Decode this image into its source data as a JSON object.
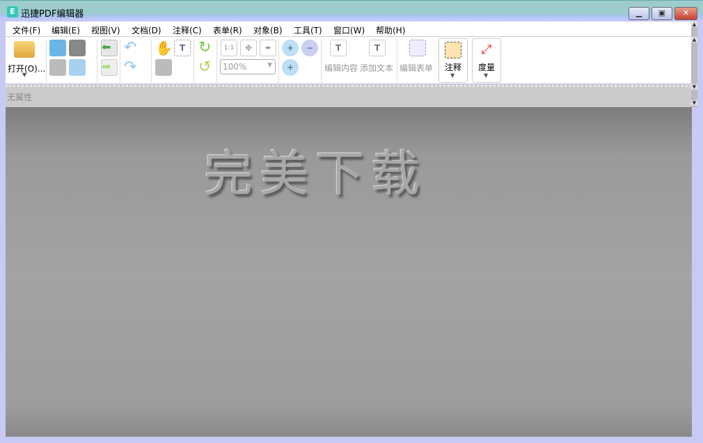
{
  "window": {
    "title": "迅捷PDF编辑器",
    "icon": "app-logo-icon"
  },
  "menu": [
    "文件(F)",
    "编辑(E)",
    "视图(V)",
    "文档(D)",
    "注释(C)",
    "表单(R)",
    "对象(B)",
    "工具(T)",
    "窗口(W)",
    "帮助(H)"
  ],
  "toolbar": {
    "open_label": "打开(O)...",
    "zoom_value": "100%",
    "edit_content": "编辑内容",
    "add_text": "添加文本",
    "edit_form": "编辑表单",
    "annotate": "注释",
    "measure": "度量",
    "fit_1to1": "1:1"
  },
  "property_bar": {
    "text": "无属性"
  },
  "document": {
    "watermark": "完美下载"
  },
  "colors": {
    "titlebar": "#9ccdcc",
    "frame": "#c9c9f5",
    "doc_bg": "#9a9a9a",
    "close": "#c84030"
  }
}
